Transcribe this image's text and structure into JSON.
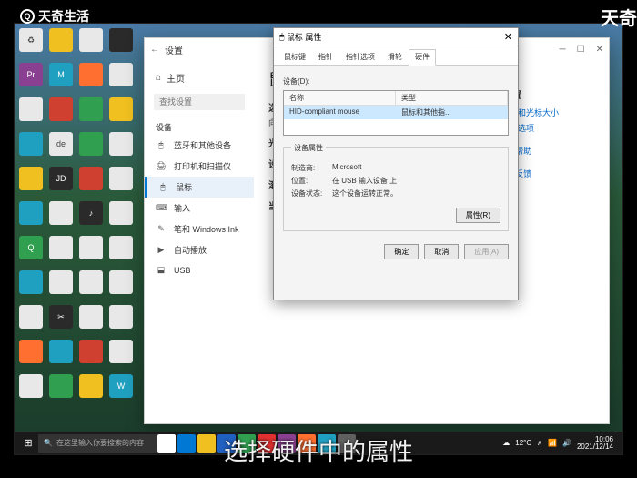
{
  "watermark": {
    "tl": "天奇生活",
    "tr": "天奇"
  },
  "subtitle": "选择硬件中的属性",
  "settings": {
    "winTitle": "设置",
    "homeLabel": "主页",
    "searchPlaceholder": "查找设置",
    "groupLabel": "设备",
    "items": [
      {
        "icon": "🖱",
        "label": "蓝牙和其他设备"
      },
      {
        "icon": "🖨",
        "label": "打印机和扫描仪"
      },
      {
        "icon": "🖱",
        "label": "鼠标",
        "active": true
      },
      {
        "icon": "⌨",
        "label": "输入"
      },
      {
        "icon": "✎",
        "label": "笔和 Windows Ink"
      },
      {
        "icon": "▶",
        "label": "自动播放"
      },
      {
        "icon": "⬓",
        "label": "USB"
      }
    ],
    "page": {
      "title": "鼠标",
      "sub1": "选择主按钮",
      "val1": "向左键",
      "sub2": "光标速度",
      "sub3": "设置滚轮滚动",
      "sub4": "滚动量设置",
      "sub5": "当我悬停在非",
      "related": {
        "title": "相关设置",
        "links": [
          "调整鼠标和光标大小",
          "其他鼠标选项"
        ],
        "help1": "获取帮助",
        "help2": "提供反馈"
      }
    }
  },
  "dialog": {
    "title": "鼠标 属性",
    "tabs": [
      "鼠标键",
      "指针",
      "指针选项",
      "滑轮",
      "硬件"
    ],
    "activeTab": 4,
    "devLabel": "设备(D):",
    "listCols": [
      "名称",
      "类型"
    ],
    "listRow": [
      "HID-compliant mouse",
      "鼠标和其他指..."
    ],
    "propsTitle": "设备属性",
    "props": [
      {
        "k": "制造商:",
        "v": "Microsoft"
      },
      {
        "k": "位置:",
        "v": "在 USB 输入设备 上"
      },
      {
        "k": "设备状态:",
        "v": "这个设备运转正常。"
      }
    ],
    "propBtn": "属性(R)",
    "footerBtns": [
      "确定",
      "取消",
      "应用(A)"
    ]
  },
  "taskbar": {
    "search": "在这里输入你要搜索的内容",
    "temp": "12°C",
    "time": "10:06",
    "date": "2021/12/14"
  }
}
